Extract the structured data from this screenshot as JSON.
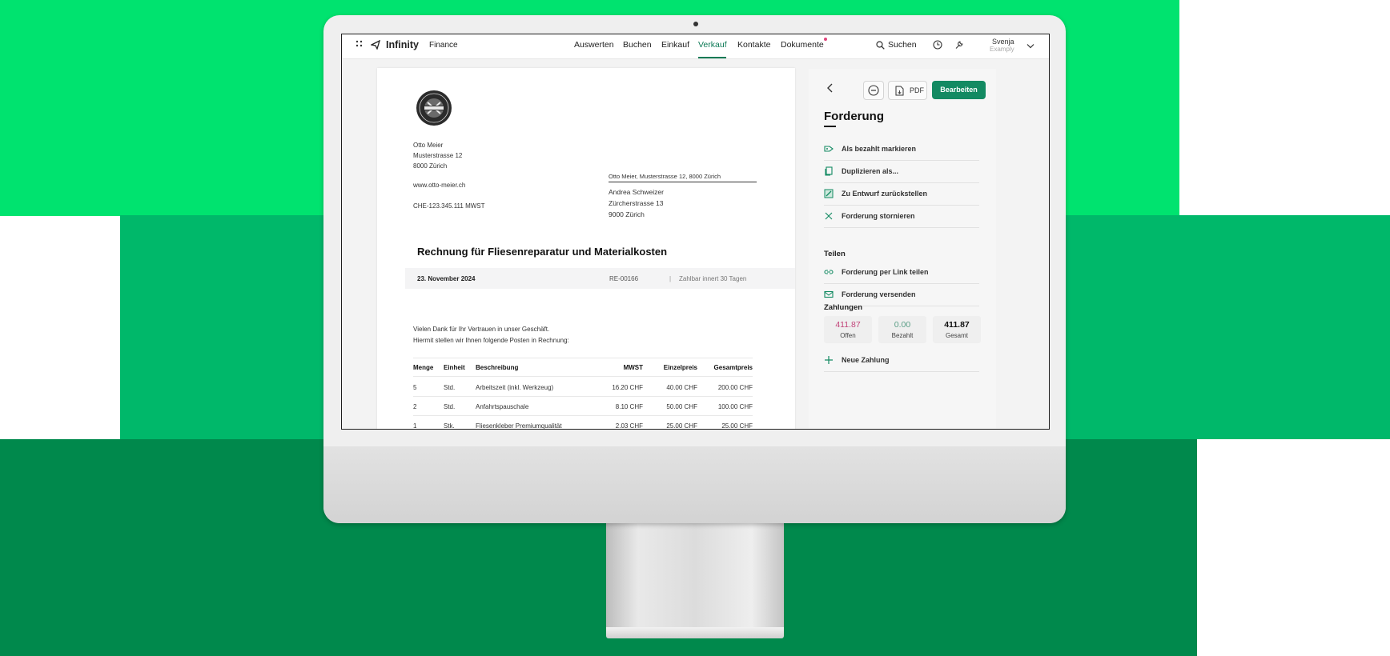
{
  "app": {
    "name": "Infinity",
    "module": "Finance"
  },
  "nav": {
    "items": [
      "Auswerten",
      "Buchen",
      "Einkauf",
      "Verkauf",
      "Kontakte",
      "Dokumente"
    ],
    "active": "Verkauf",
    "search_label": "Suchen",
    "user_name": "Svenja",
    "user_org": "Examply"
  },
  "invoice": {
    "sender_name": "Otto Meier",
    "sender_street": "Musterstrasse 12",
    "sender_city": "8000 Zürich",
    "sender_web": "www.otto-meier.ch",
    "sender_vat": "CHE-123.345.111 MWST",
    "return_address": "Otto Meier, Musterstrasse 12, 8000 Zürich",
    "recipient_name": "Andrea Schweizer",
    "recipient_street": "Zürcherstrasse 13",
    "recipient_city": "9000 Zürich",
    "title": "Rechnung für Fliesenreparatur und Materialkosten",
    "date": "23. November 2024",
    "number": "RE-00166",
    "separator": "|",
    "payment_terms": "Zahlbar innert 30 Tagen",
    "intro_line1": "Vielen Dank für Ihr Vertrauen in unser Geschäft.",
    "intro_line2": "Hiermit stellen wir Ihnen folgende Posten in Rechnung:",
    "columns": [
      "Menge",
      "Einheit",
      "Beschreibung",
      "MWST",
      "Einzelpreis",
      "Gesamtpreis"
    ],
    "rows": [
      [
        "5",
        "Std.",
        "Arbeitszeit (inkl. Werkzeug)",
        "16.20 CHF",
        "40.00 CHF",
        "200.00 CHF"
      ],
      [
        "2",
        "Std.",
        "Anfahrtspauschale",
        "8.10 CHF",
        "50.00 CHF",
        "100.00 CHF"
      ],
      [
        "1",
        "Stk.",
        "Fliesenkleber Premiumqualität",
        "2.03 CHF",
        "25.00 CHF",
        "25.00 CHF"
      ]
    ]
  },
  "panel": {
    "pdf_label": "PDF",
    "edit_label": "Bearbeiten",
    "title": "Forderung",
    "actions": [
      "Als bezahlt markieren",
      "Duplizieren als...",
      "Zu Entwurf zurückstellen",
      "Forderung stornieren"
    ],
    "share_title": "Teilen",
    "share_actions": [
      "Forderung per Link teilen",
      "Forderung versenden"
    ],
    "payments_title": "Zahlungen",
    "payments": [
      {
        "value": "411.87",
        "label": "Offen"
      },
      {
        "value": "0.00",
        "label": "Bezahlt"
      },
      {
        "value": "411.87",
        "label": "Gesamt"
      }
    ],
    "new_payment_label": "Neue Zahlung"
  },
  "colors": {
    "accent": "#138a62",
    "open_amount": "#c2447a",
    "paid_amount": "#5a9e86",
    "bg_top": "#00e36f",
    "bg_mid": "#00b86a",
    "bg_bottom": "#00894c"
  }
}
